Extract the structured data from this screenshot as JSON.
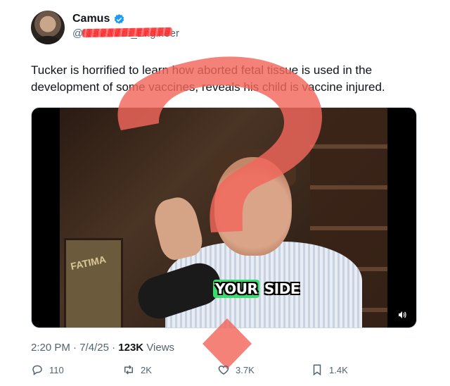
{
  "author": {
    "name": "Camus",
    "handle": "@NewsWire_Engineer",
    "verified": true
  },
  "tweet": {
    "text": "Tucker is horrified to learn how aborted fetal tissue is used in the development of some vaccines, reveals his child is vaccine injured."
  },
  "video": {
    "caption_highlight": "YOUR",
    "caption_rest": " SIDE",
    "poster_text": "FATIMA"
  },
  "meta": {
    "time": "2:20 PM",
    "date": "7/4/25",
    "views_count": "123K",
    "views_label": "Views"
  },
  "actions": {
    "replies": "110",
    "reposts": "2K",
    "likes": "3.7K",
    "bookmarks": "1.4K"
  },
  "colors": {
    "verified": "#1d9bf0",
    "overlay_question_mark": "#f2665c",
    "redaction": "#ff2b2b",
    "caption_highlight": "#35e06a"
  }
}
